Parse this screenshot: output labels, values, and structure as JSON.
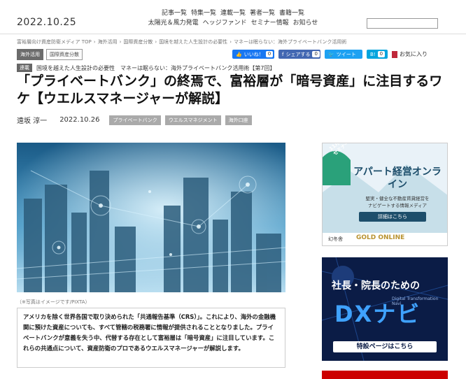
{
  "header": {
    "date": "2022.10.25",
    "nav_row1": [
      "記事一覧",
      "特集一覧",
      "連載一覧",
      "著者一覧",
      "書籍一覧"
    ],
    "nav_row2": [
      "太陽光＆風力発電",
      "ヘッジファンド",
      "セミナー情報",
      "お知らせ"
    ]
  },
  "breadcrumb": [
    "富裕層向け資産防衛メディア TOP",
    "海外活用",
    "国際資産分散",
    "国境を越えた人生設計の必要性",
    "マネーは眠らない：海外プライベートバンク活用術"
  ],
  "category_tags": [
    "海外活用",
    "国際資産分散"
  ],
  "social": {
    "like_label": "いいね！",
    "like_count": "0",
    "share_label": "シェアする",
    "share_count": "0",
    "tweet_label": "ツイート",
    "hatena_label": "B!",
    "hatena_count": "0",
    "favorite_label": "お気に入り"
  },
  "series": {
    "badge": "連載",
    "text": "国境を越えた人生設計の必要性　マネーは眠らない：海外プライベートバンク活用術【第7回】"
  },
  "article": {
    "title": "「プライベートバンク」の終焉で、富裕層が「暗号資産」に注目するワケ【ウエルスマネージャーが解説】",
    "author": "遠坂 淳一",
    "date": "2022.10.26",
    "tags": [
      "プライベートバンク",
      "ウエルスマネジメント",
      "海外口座"
    ],
    "image_caption": "（※写真はイメージです/PIXTA）",
    "lead": "アメリカを除く世界各国で取り決められた「共通報告基準（CRS）」。これにより、海外の金融機関に預けた資産についても、すべて管轄の税務署に情報が提供されることとなりました。プライベートバンクが意義を失う中、代替する存在として富裕層は「暗号資産」に注目しています。これらの共通点について、資産防衛のプロであるウエルスマネージャーが解説します。"
  },
  "ads": {
    "ad1": {
      "date_badge": "11月23日(土)",
      "badge_sub": "セミナー開催",
      "heading": "アパート経営オンライン",
      "body": "堅実・健全な不動産賃貸経営を",
      "body2": "ナビゲートする情報メディア",
      "button": "詳細はこちら",
      "footer_left": "幻冬舎",
      "footer_brand": "GOLD ONLINE"
    },
    "ad2": {
      "heading1": "社長・院長のための",
      "heading2": "DXナビ",
      "sub": "Digital Transformation Navi",
      "button": "特設ページはこちら"
    }
  },
  "colors": {
    "facebook": "#1877f2",
    "twitter": "#1da1f2",
    "hatena": "#00a4de",
    "ad_navy": "#0b1c46",
    "ad_green": "#2aa17a"
  }
}
